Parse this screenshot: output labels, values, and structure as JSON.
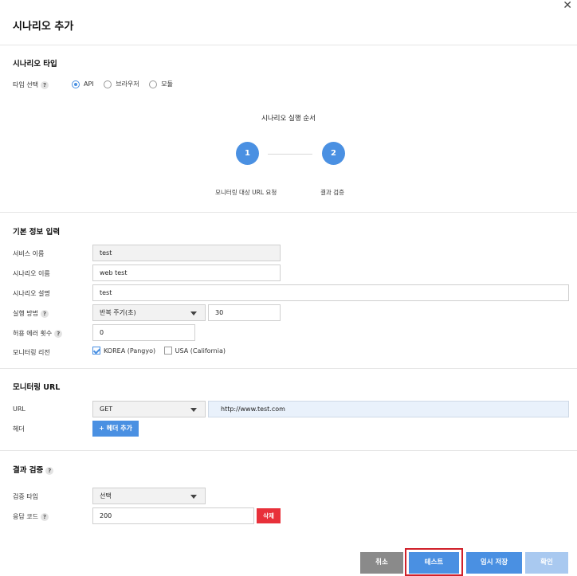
{
  "dialog": {
    "title": "시나리오 추가",
    "close_label": "✕"
  },
  "scenario_type": {
    "section_title": "시나리오 타입",
    "type_label": "타입 선택",
    "options": [
      "API",
      "브라우저",
      "모듈"
    ],
    "selected": "API"
  },
  "steps": {
    "title": "시나리오 실행 순서",
    "items": [
      {
        "number": "1",
        "label": "모니터링 대상 URL 요청"
      },
      {
        "number": "2",
        "label": "결과 검증"
      }
    ]
  },
  "basic_info": {
    "section_title": "기본 정보 입력",
    "service_name_label": "서비스 이름",
    "service_name_value": "test",
    "scenario_name_label": "시나리오 이름",
    "scenario_name_value": "web test",
    "scenario_desc_label": "시나리오 설명",
    "scenario_desc_value": "test",
    "exec_method_label": "실행 방법",
    "exec_method_value": "반복 주기(초)",
    "exec_interval_value": "30",
    "error_count_label": "허용 에러 횟수",
    "error_count_value": "0",
    "region_label": "모니터링 리전",
    "regions": [
      {
        "label": "KOREA (Pangyo)",
        "checked": true
      },
      {
        "label": "USA (California)",
        "checked": false
      }
    ]
  },
  "monitoring_url": {
    "section_title": "모니터링 URL",
    "url_label": "URL",
    "method_value": "GET",
    "url_value": "http://www.test.com",
    "header_label": "헤더",
    "add_header_label": "+ 헤더 추가"
  },
  "result_check": {
    "section_title": "결과 검증",
    "check_type_label": "검증 타입",
    "check_type_value": "선택",
    "response_code_label": "응답 코드",
    "response_code_value": "200",
    "delete_label": "삭제"
  },
  "footer": {
    "cancel_label": "취소",
    "test_label": "테스트",
    "temp_save_label": "임시 저장",
    "confirm_label": "확인"
  },
  "colors": {
    "accent": "#4a90e2",
    "danger": "#e8303a",
    "highlight": "#d0202a"
  }
}
